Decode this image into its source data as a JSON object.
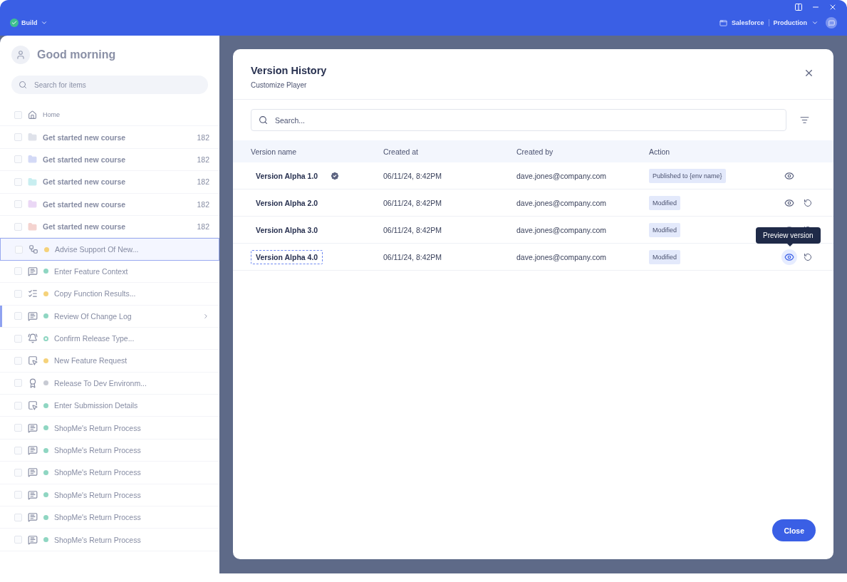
{
  "topbar": {
    "mode": "Build",
    "platform": "Salesforce",
    "environment": "Production"
  },
  "sidebar": {
    "greeting": "Good morning",
    "search": {
      "placeholder": "Search for items"
    },
    "home": {
      "label": "Home",
      "checked": false
    },
    "folders": [
      {
        "label": "Get started new course",
        "count": "182",
        "color": "#dfe2ea",
        "checked": false
      },
      {
        "label": "Get started new course",
        "count": "182",
        "color": "#d3d9f6",
        "checked": false
      },
      {
        "label": "Get started new course",
        "count": "182",
        "color": "#c8eef0",
        "checked": false
      },
      {
        "label": "Get started new course",
        "count": "182",
        "color": "#ead7f5",
        "checked": false
      },
      {
        "label": "Get started new course",
        "count": "182",
        "color": "#f4d3cf",
        "checked": false
      }
    ],
    "items": [
      {
        "label": "Advise Support Of New...",
        "kind": "flow",
        "color": "#f5d27a",
        "hollow": false,
        "selected": true,
        "expandable": false,
        "checked": false
      },
      {
        "label": "Enter Feature Context",
        "kind": "tip",
        "color": "#8fd6c2",
        "hollow": false,
        "selected": false,
        "expandable": false,
        "checked": false
      },
      {
        "label": "Copy Function Results...",
        "kind": "list",
        "color": "#f5d27a",
        "hollow": false,
        "selected": false,
        "expandable": false,
        "checked": false
      },
      {
        "label": "Review Of Change Log",
        "kind": "tip",
        "color": "#8fd6c2",
        "hollow": false,
        "selected": false,
        "expandable": true,
        "checked": false
      },
      {
        "label": "Confirm Release Type...",
        "kind": "bell",
        "color": "#8fd6c2",
        "hollow": true,
        "selected": false,
        "expandable": false,
        "checked": false
      },
      {
        "label": "New Feature Request",
        "kind": "pointer",
        "color": "#f5d27a",
        "hollow": false,
        "selected": false,
        "expandable": false,
        "checked": false
      },
      {
        "label": "Release To Dev Environm...",
        "kind": "badge",
        "color": "#c7cad3",
        "hollow": false,
        "selected": false,
        "expandable": false,
        "checked": false
      },
      {
        "label": "Enter Submission Details",
        "kind": "pointer",
        "color": "#8fd6c2",
        "hollow": false,
        "selected": false,
        "expandable": false,
        "checked": false
      },
      {
        "label": "ShopMe's Return Process",
        "kind": "tip",
        "color": "#8fd6c2",
        "hollow": false,
        "selected": false,
        "expandable": false,
        "checked": false
      },
      {
        "label": "ShopMe's Return Process",
        "kind": "tip",
        "color": "#8fd6c2",
        "hollow": false,
        "selected": false,
        "expandable": false,
        "checked": false
      },
      {
        "label": "ShopMe's Return Process",
        "kind": "tip",
        "color": "#8fd6c2",
        "hollow": false,
        "selected": false,
        "expandable": false,
        "checked": false
      },
      {
        "label": "ShopMe's Return Process",
        "kind": "tip",
        "color": "#8fd6c2",
        "hollow": false,
        "selected": false,
        "expandable": false,
        "checked": false
      },
      {
        "label": "ShopMe's Return Process",
        "kind": "tip",
        "color": "#8fd6c2",
        "hollow": false,
        "selected": false,
        "expandable": false,
        "checked": false
      },
      {
        "label": "ShopMe's Return Process",
        "kind": "tip",
        "color": "#8fd6c2",
        "hollow": false,
        "selected": false,
        "expandable": false,
        "checked": false
      }
    ]
  },
  "modal": {
    "title": "Version History",
    "subtitle": "Customize Player",
    "search": {
      "placeholder": "Search..."
    },
    "columns": [
      "Version name",
      "Created at",
      "Created by",
      "Action"
    ],
    "rows": [
      {
        "name": "Version Alpha 1.0",
        "verified": true,
        "focused": false,
        "created_at": "06/11/24, 8:42PM",
        "created_by": "dave.jones@company.com",
        "status": "Published to {env name}",
        "restorable": false,
        "preview_active": false
      },
      {
        "name": "Version Alpha 2.0",
        "verified": false,
        "focused": false,
        "created_at": "06/11/24, 8:42PM",
        "created_by": "dave.jones@company.com",
        "status": "Modified",
        "restorable": true,
        "preview_active": false
      },
      {
        "name": "Version Alpha 3.0",
        "verified": false,
        "focused": false,
        "created_at": "06/11/24, 8:42PM",
        "created_by": "dave.jones@company.com",
        "status": "Modified",
        "restorable": true,
        "preview_active": false
      },
      {
        "name": "Version Alpha 4.0",
        "verified": false,
        "focused": true,
        "created_at": "06/11/24, 8:42PM",
        "created_by": "dave.jones@company.com",
        "status": "Modified",
        "restorable": true,
        "preview_active": true
      }
    ],
    "tooltip": "Preview version",
    "close_button": "Close"
  }
}
